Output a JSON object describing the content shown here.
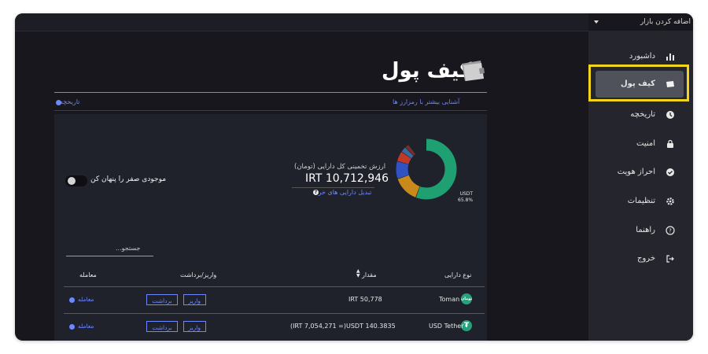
{
  "market": {
    "label": "اضافه کردن بازار"
  },
  "sidebar": {
    "items": [
      {
        "label": "داشبورد",
        "icon": "bar-chart-icon"
      },
      {
        "label": "کیف پول",
        "icon": "wallet-icon",
        "active": true
      },
      {
        "label": "تاریخچه",
        "icon": "history-icon"
      },
      {
        "label": "امنیت",
        "icon": "lock-icon"
      },
      {
        "label": "احراز هویت",
        "icon": "verified-icon"
      },
      {
        "label": "تنظیمات",
        "icon": "gear-icon"
      },
      {
        "label": "راهنما",
        "icon": "help-icon"
      },
      {
        "label": "خروج",
        "icon": "logout-icon"
      }
    ]
  },
  "page": {
    "title": "کیف پول",
    "learn_link": "آشنایی بیشتر با رمزارز ها",
    "history_link": "تاریخچه"
  },
  "summary": {
    "estimate_label": "ارزش تخمینی کل دارایی (تومان)",
    "estimate_value": "IRT 10,712,946",
    "convert_link": "تبدیل دارایی های خرد",
    "hide_zero_label": "موجودی صفر را پنهان کن",
    "hide_zero_enabled": false
  },
  "chart_data": {
    "type": "pie",
    "categories": [
      "USDT",
      "",
      "",
      "",
      "",
      ""
    ],
    "values": [
      65.8,
      14.0,
      9.5,
      5.5,
      3.0,
      2.2
    ],
    "annotations": [
      "USDT",
      "65.8%"
    ]
  },
  "colors": {
    "accent": "#6c88ff",
    "highlight": "#f2d51b",
    "slices": [
      "#1ea073",
      "#c98a1b",
      "#2f53c4",
      "#c0392b",
      "#3a6a9c",
      "#7a2b2b"
    ]
  },
  "search": {
    "placeholder": "جستجو..."
  },
  "table": {
    "headers": {
      "asset": "نوع دارایی",
      "amount": "مقدار",
      "deposit_withdraw": "واریز/برداشت",
      "trade": "معامله"
    },
    "rows": [
      {
        "name": "Toman",
        "coin_text": "تومان",
        "amount": "IRT 50,778",
        "deposit": "واریز",
        "withdraw": "برداشت",
        "trade": "معامله"
      },
      {
        "name": "USD Tether",
        "coin_text": "₮",
        "amount": "(IRT 7,054,271 =)USDT 140.3835",
        "deposit": "واریز",
        "withdraw": "برداشت",
        "trade": "معامله"
      }
    ]
  }
}
